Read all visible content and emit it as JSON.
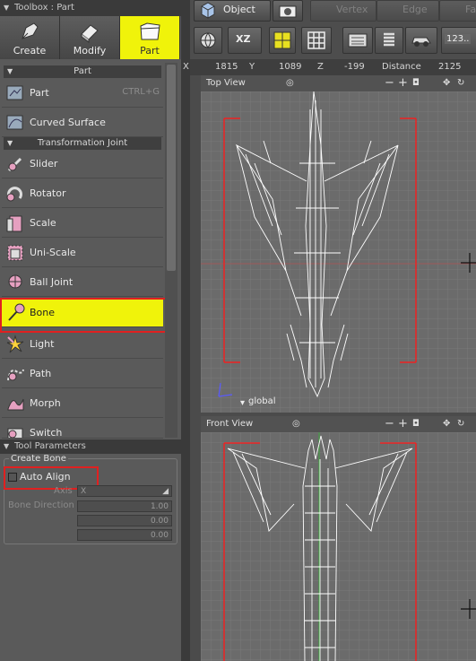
{
  "toolbox": {
    "title": "Toolbox : Part",
    "tabs": [
      {
        "label": "Create",
        "icon": "pen-icon"
      },
      {
        "label": "Modify",
        "icon": "eraser-icon"
      },
      {
        "label": "Part",
        "icon": "folder-icon",
        "active": true
      }
    ],
    "sections": [
      {
        "title": "Part"
      },
      {
        "title": "Transformation Joint"
      }
    ],
    "items": [
      {
        "label": "Part",
        "shortcut": "CTRL+G",
        "icon": "part-icon"
      },
      {
        "label": "Curved Surface",
        "icon": "curved-surface-icon"
      },
      {
        "label": "Slider",
        "icon": "slider-icon"
      },
      {
        "label": "Rotator",
        "icon": "rotator-icon"
      },
      {
        "label": "Scale",
        "icon": "scale-icon"
      },
      {
        "label": "Uni-Scale",
        "icon": "uni-scale-icon"
      },
      {
        "label": "Ball Joint",
        "icon": "ball-joint-icon"
      },
      {
        "label": "Bone",
        "icon": "bone-icon",
        "selected": true
      },
      {
        "label": "Light",
        "icon": "light-icon"
      },
      {
        "label": "Path",
        "icon": "path-icon"
      },
      {
        "label": "Morph",
        "icon": "morph-icon"
      },
      {
        "label": "Switch",
        "icon": "switch-icon"
      }
    ]
  },
  "tool_params": {
    "title": "Tool Parameters",
    "group": "Create Bone",
    "auto_align": "Auto Align",
    "axis_label": "Axis",
    "axis_value": "X",
    "bone_direction_label": "Bone Direction",
    "dir_x": "1.00",
    "dir_y": "0.00",
    "dir_z": "0.00"
  },
  "toolbar": {
    "object": "Object",
    "vertex": "Vertex",
    "edge": "Edge",
    "face": "Fa",
    "plane": "XZ",
    "numeric": "123.."
  },
  "coords": {
    "x_label": "X",
    "x": "1815",
    "y_label": "Y",
    "y": "1089",
    "z_label": "Z",
    "z": "-199",
    "distance_label": "Distance",
    "distance": "2125"
  },
  "viewports": {
    "top": {
      "title": "Top View",
      "global": "global"
    },
    "front": {
      "title": "Front View"
    }
  },
  "colors": {
    "accent": "#f0f30a",
    "highlight": "#e02020",
    "grid": "#7a7a7a",
    "wire": "#ffffff"
  }
}
